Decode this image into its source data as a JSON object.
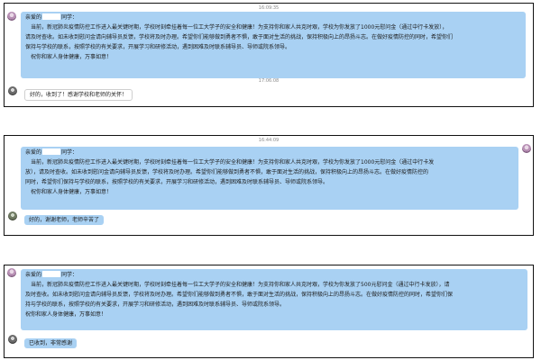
{
  "conversations": [
    {
      "timestamp_top": "16:09:35",
      "message": {
        "greeting_prefix": "亲爱的",
        "greeting_suffix": "同学：",
        "lines": [
          "当前，新冠肺炎疫情防控工作进入最关键时期，学校时刻牵挂着每一位工大学子的安全和健康！为支持你和家人共克时艰，学校为你发放了1000元慰问金（通过中行卡发放），",
          "请及时查收。如未收到慰问金请向辅导员反馈，学校将及时办理。希望你们能够做到勇者不惧，敢于面对生活的挑战，保持积极向上的昂扬斗志。在做好疫情防控的同时，希望你们",
          "保持与学校的联系，按照学校的有关要求，开展学习和研修活动，遇到困难及时联系辅导员、导师或院系领导。",
          "祝你和家人身体健康，万事如意！"
        ]
      },
      "timestamp_reply": "17:06:08",
      "reply": "好的，收到了！感谢学校和老师的关怀！"
    },
    {
      "timestamp_top": "16:44:09",
      "message": {
        "greeting_prefix": "亲爱的",
        "greeting_suffix": "同学：",
        "lines": [
          "当前，新冠肺炎疫情防控工作进入最关键时期，学校时刻牵挂着每一位工大学子的安全和健康！为支持你和家人共克时艰，学校为你发放了1000元慰问金（通过中行卡发",
          "放），请及时查收。如未收到慰问金请向辅导员反馈，学校将及时办理。希望你们能够做到勇者不惧，敢于面对生活的挑战，保持积极向上的昂扬斗志。在做好疫情防控的",
          "同时，希望你们保持与学校的联系，按照学校的有关要求，开展学习和研修活动，遇到困难及时联系辅导员、导师或院系领导。",
          "祝你和家人身体健康，万事如意！"
        ]
      },
      "reply": "好的，谢谢老师，老师辛苦了"
    },
    {
      "message": {
        "greeting_prefix": "亲爱的",
        "greeting_suffix": "同学：",
        "lines": [
          "当前，新冠肺炎疫情防控工作进入最关键时期，学校时刻牵挂着每一位工大学子的安全和健康！为支持你和家人共克时艰，学校为你发放了500元慰问金（通过中行卡发放），请",
          "及时查收。如未收到慰问金请向辅导员反馈，学校将及时办理。希望你们能够做到勇者不惧，敢于面对生活的挑战，保持积极向上的昂扬斗志。在做好疫情防控的同时，希望你们保",
          "持与学校的联系，按照学校的有关要求，开展学习和研修活动，遇到困难及时联系辅导员、导师或院系领导。",
          "祝你和家人身体健康，万事如意！"
        ]
      },
      "reply": "已收到，非常感谢"
    }
  ]
}
